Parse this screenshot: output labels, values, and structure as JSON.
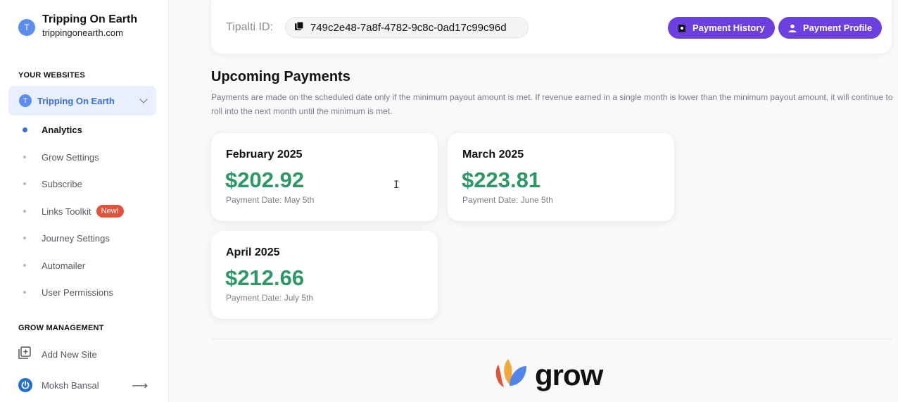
{
  "sidebar": {
    "site_initial": "T",
    "site_name": "Tripping On Earth",
    "site_domain": "trippingonearth.com",
    "your_websites_title": "YOUR WEBSITES",
    "selected_site": "Tripping On Earth",
    "nav": [
      {
        "label": "Analytics",
        "active": true
      },
      {
        "label": "Grow Settings"
      },
      {
        "label": "Subscribe"
      },
      {
        "label": "Links Toolkit",
        "badge": "New!"
      },
      {
        "label": "Journey Settings"
      },
      {
        "label": "Automailer"
      },
      {
        "label": "User Permissions"
      }
    ],
    "grow_management_title": "GROW MANAGEMENT",
    "add_new_site": "Add New Site",
    "user_name": "Moksh Bansal"
  },
  "top_card": {
    "tipalti_label": "Tipalti ID:",
    "tipalti_id": "749c2e48-7a8f-4782-9c8c-0ad17c99c96d",
    "payment_history": "Payment History",
    "payment_profile": "Payment Profile"
  },
  "upcoming": {
    "title": "Upcoming Payments",
    "description": "Payments are made on the scheduled date only if the minimum payout amount is met. If revenue earned in a single month is lower than the minimum payout amount, it will continue to roll into the next month until the minimum is met.",
    "payments": [
      {
        "month": "February 2025",
        "amount": "$202.92",
        "date": "Payment Date: May 5th"
      },
      {
        "month": "March 2025",
        "amount": "$223.81",
        "date": "Payment Date: June 5th"
      },
      {
        "month": "April 2025",
        "amount": "$212.66",
        "date": "Payment Date: July 5th"
      }
    ]
  },
  "footer": {
    "logo_text": "grow"
  },
  "colors": {
    "accent_purple": "#6b3fe0",
    "amount_green": "#2c9868",
    "site_blue": "#3a6de0",
    "badge_red": "#e0533b"
  }
}
